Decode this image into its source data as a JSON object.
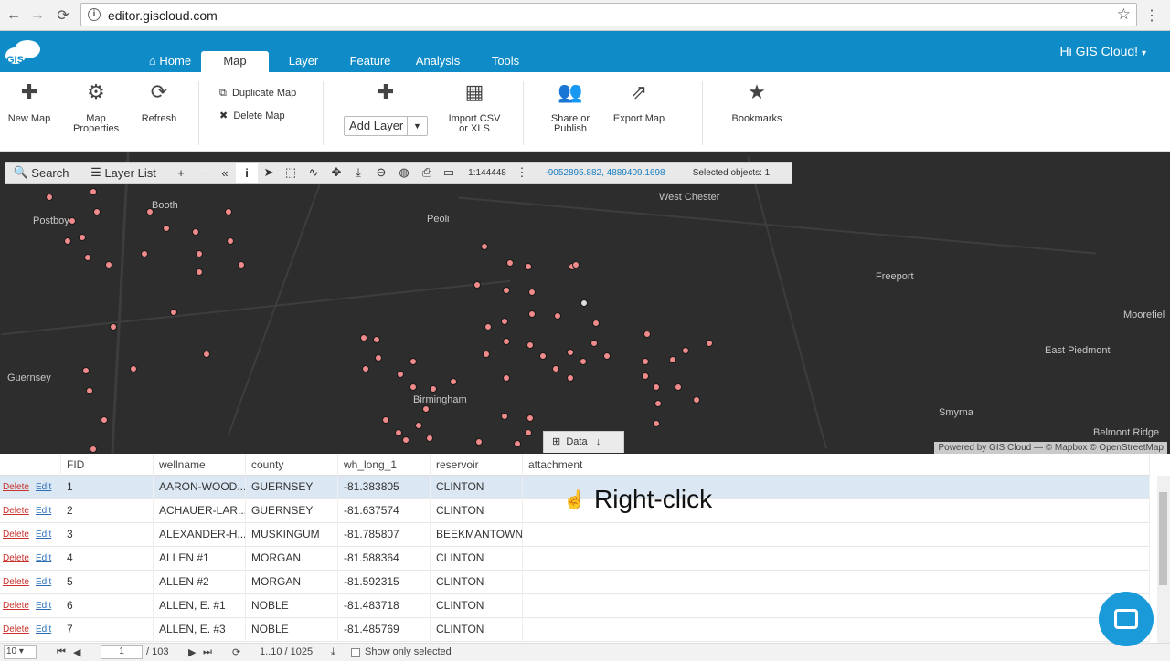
{
  "browser": {
    "url": "editor.giscloud.com"
  },
  "app": {
    "logo_text": "GIS",
    "greeting": "Hi GIS Cloud!",
    "tabs": [
      {
        "label": "Home"
      },
      {
        "label": "Map"
      },
      {
        "label": "Layer"
      },
      {
        "label": "Feature"
      },
      {
        "label": "Analysis"
      },
      {
        "label": "Tools"
      }
    ]
  },
  "ribbon": {
    "new_map": "New Map",
    "map_properties": "Map Properties",
    "refresh": "Refresh",
    "duplicate_map": "Duplicate Map",
    "delete_map": "Delete Map",
    "add_layer": "Add Layer",
    "import_csv": "Import CSV or XLS",
    "share": "Share or Publish",
    "export_map": "Export Map",
    "bookmarks": "Bookmarks"
  },
  "map": {
    "search": "Search",
    "layer_list": "Layer List",
    "scale": "1:144448",
    "coords": "-9052895.882, 4889409.1698",
    "selected": "Selected objects: 1",
    "attribution": "Powered by GIS Cloud — © Mapbox © OpenStreetMap",
    "data_tab": "Data",
    "places": [
      "Booth",
      "West Chester",
      "Postboy",
      "Peoli",
      "Freeport",
      "Moorefiel",
      "East Piedmont",
      "Guernsey",
      "Birmingham",
      "Smyrna",
      "Belmont Ridge"
    ]
  },
  "table": {
    "columns": [
      "FID",
      "wellname",
      "county",
      "wh_long_1",
      "reservoir",
      "attachment"
    ],
    "delete_label": "Delete",
    "edit_label": "Edit",
    "rows": [
      {
        "fid": "1",
        "wellname": "AARON-WOOD...",
        "county": "GUERNSEY",
        "wh_long": "-81.383805",
        "reservoir": "CLINTON"
      },
      {
        "fid": "2",
        "wellname": "ACHAUER-LAR...",
        "county": "GUERNSEY",
        "wh_long": "-81.637574",
        "reservoir": "CLINTON"
      },
      {
        "fid": "3",
        "wellname": "ALEXANDER-H...",
        "county": "MUSKINGUM",
        "wh_long": "-81.785807",
        "reservoir": "BEEKMANTOWN"
      },
      {
        "fid": "4",
        "wellname": "ALLEN #1",
        "county": "MORGAN",
        "wh_long": "-81.588364",
        "reservoir": "CLINTON"
      },
      {
        "fid": "5",
        "wellname": "ALLEN #2",
        "county": "MORGAN",
        "wh_long": "-81.592315",
        "reservoir": "CLINTON"
      },
      {
        "fid": "6",
        "wellname": "ALLEN, E. #1",
        "county": "NOBLE",
        "wh_long": "-81.483718",
        "reservoir": "CLINTON"
      },
      {
        "fid": "7",
        "wellname": "ALLEN, E. #3",
        "county": "NOBLE",
        "wh_long": "-81.485769",
        "reservoir": "CLINTON"
      }
    ]
  },
  "overlay": {
    "right_click": "Right-click"
  },
  "pager": {
    "page_size": "10",
    "page": "1",
    "total_pages": "/ 103",
    "range": "1..10 / 1025",
    "show_only_selected": "Show only selected"
  }
}
